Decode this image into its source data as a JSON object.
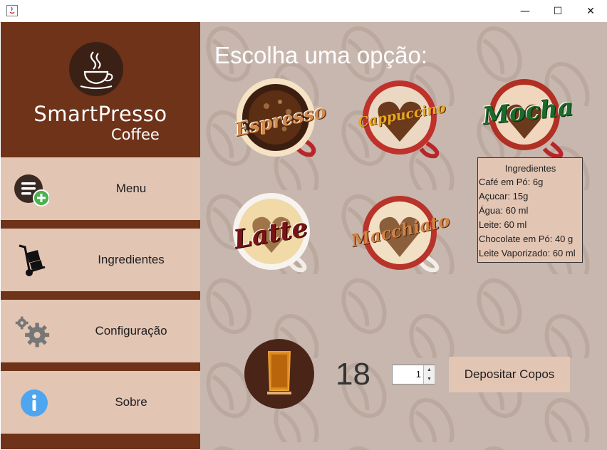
{
  "window": {
    "minimize_glyph": "—",
    "maximize_glyph": "☐",
    "close_glyph": "✕"
  },
  "sidebar": {
    "logo_title": "SmartPresso",
    "logo_subtitle": "Coffee",
    "items": [
      {
        "label": "Menu",
        "icon": "menu-add-icon"
      },
      {
        "label": "Ingredientes",
        "icon": "hand-truck-icon"
      },
      {
        "label": "Configuração",
        "icon": "gears-icon"
      },
      {
        "label": "Sobre",
        "icon": "info-icon"
      }
    ]
  },
  "main": {
    "heading": "Escolha uma opção:",
    "coffees": [
      {
        "label": "Espresso"
      },
      {
        "label": "Cappuccino"
      },
      {
        "label": "Mocha"
      },
      {
        "label": "Latte"
      },
      {
        "label": "Macchiato"
      }
    ],
    "tooltip": {
      "title": "Ingredientes",
      "lines": [
        "Café em Pó: 6g",
        "Açucar: 15g",
        "Água: 60 ml",
        "Leite: 60 ml",
        "Chocolate em Pó: 40 g",
        "Leite Vaporizado: 60 ml"
      ]
    },
    "cup_count": "18",
    "spinner_value": "1",
    "deposit_label": "Depositar Copos"
  },
  "colors": {
    "sidebar_bg": "#6e3318",
    "nav_item_bg": "#e3c5b4",
    "content_bg": "#c8b7ae",
    "button_bg": "#e3c5b4"
  }
}
